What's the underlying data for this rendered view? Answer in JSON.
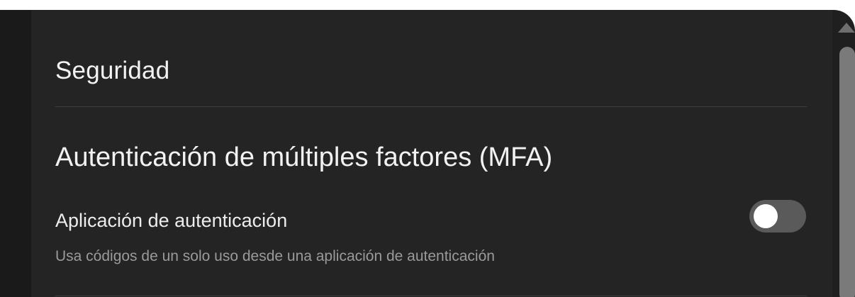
{
  "panel": {
    "title": "Seguridad"
  },
  "mfa": {
    "heading": "Autenticación de múltiples factores (MFA)",
    "authenticator_app": {
      "label": "Aplicación de autenticación",
      "description": "Usa códigos de un solo uso desde una aplicación de autenticación",
      "enabled": false
    }
  },
  "colors": {
    "background": "#242424",
    "text_primary": "#f2f2f2",
    "text_secondary": "#9a9a9a",
    "toggle_off_track": "#5a5a5a",
    "toggle_knob": "#ffffff"
  },
  "icons": {
    "scroll_up": "scroll-up-arrow-icon"
  }
}
